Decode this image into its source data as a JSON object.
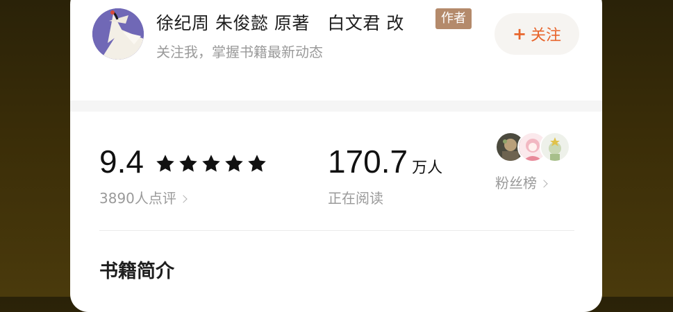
{
  "author": {
    "name": "徐纪周 朱俊懿 原著　白文君 改",
    "badge": "作者",
    "subtitle": "关注我，掌握书籍最新动态",
    "avatar_icon": "crane-avatar-icon",
    "follow_label": "关注",
    "follow_icon": "plus-icon"
  },
  "stats": {
    "rating": {
      "value": "9.4",
      "stars": 5,
      "reviews": "3890人点评"
    },
    "readers": {
      "value": "170.7",
      "unit": "万人",
      "label": "正在阅读"
    },
    "fans": {
      "label": "粉丝榜",
      "avatar_count": 3
    }
  },
  "sections": {
    "intro_title": "书籍简介"
  },
  "colors": {
    "accent": "#e8652c",
    "badge": "#b48a6b",
    "muted": "#9a9a9a",
    "text": "#111111"
  }
}
